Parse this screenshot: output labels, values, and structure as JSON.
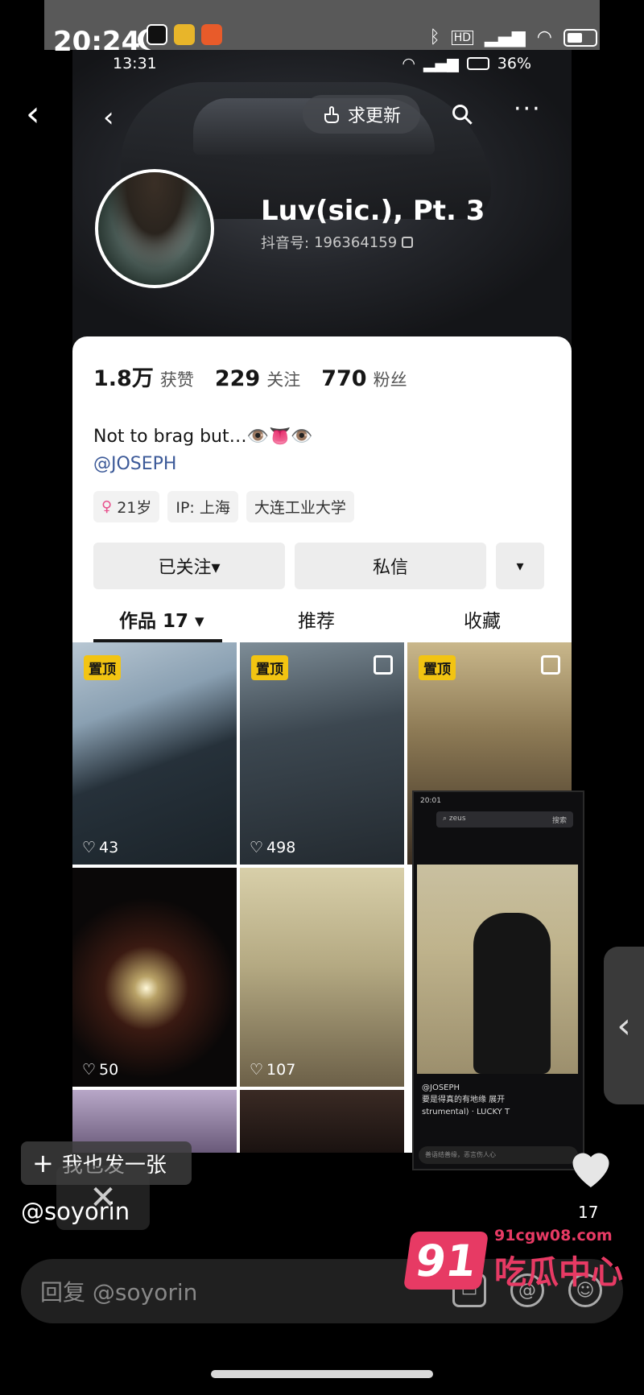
{
  "outer_status": {
    "time": "20:24",
    "network_type": "HD",
    "battery_label": ""
  },
  "inner_status": {
    "time": "13:31",
    "battery": "36%"
  },
  "profile_nav": {
    "refresh_label": "求更新"
  },
  "profile": {
    "nickname": "Luv(sic.), Pt. 3",
    "douyin_id_label": "抖音号:",
    "douyin_id": "196364159",
    "stats": [
      {
        "value": "1.8万",
        "label": "获赞"
      },
      {
        "value": "229",
        "label": "关注"
      },
      {
        "value": "770",
        "label": "粉丝"
      }
    ],
    "bio": "Not to brag but…👁️👅👁️",
    "mention": "@JOSEPH",
    "tags": [
      {
        "text": "21岁",
        "icon": "gender-female-icon"
      },
      {
        "text": "IP: 上海"
      },
      {
        "text": "大连工业大学"
      }
    ],
    "buttons": {
      "follow": "已关注▾",
      "message": "私信",
      "more": "▾"
    },
    "tabs": [
      "作品 17 ▾",
      "推荐",
      "收藏"
    ]
  },
  "grid": [
    {
      "pinned": "置顶",
      "likes": "43",
      "multi": false
    },
    {
      "pinned": "置顶",
      "likes": "498",
      "multi": true
    },
    {
      "pinned": "置顶",
      "likes": "",
      "multi": true
    },
    {
      "pinned": "",
      "likes": "50",
      "multi": false
    },
    {
      "pinned": "",
      "likes": "107",
      "multi": false
    }
  ],
  "overlay_shot": {
    "status_time": "20:01",
    "search": "zeus",
    "search_action": "搜索",
    "user": "@JOSEPH",
    "caption": "要是得真的有地缘 展开",
    "music": "strumental) · LUCKY T",
    "input_placeholder": "善语结善缘，恶言伤人心"
  },
  "bottom": {
    "post_button": "我也发一张",
    "handle": "@soyorin",
    "like_count": "17",
    "reply_placeholder": "回复 @soyorin"
  },
  "watermark": {
    "number": "91",
    "url": "91cgw08.com",
    "text": "吃瓜中心"
  },
  "colors": {
    "accent_yellow": "#f2c412",
    "watermark_pink": "#e73a64",
    "mention_blue": "#3b5998"
  }
}
